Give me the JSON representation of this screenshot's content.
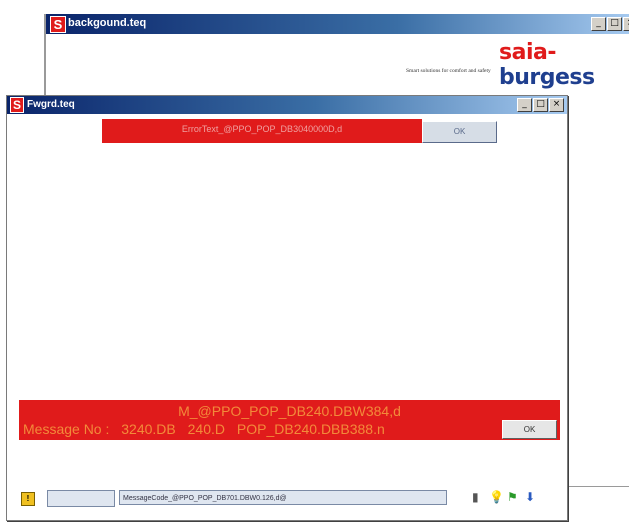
{
  "background_window": {
    "title": "backgound.teq",
    "brand_part1": "saia",
    "brand_sep": "-",
    "brand_part2": "burgess",
    "tagline": "Smart solutions for comfort and safety",
    "controls": [
      "_",
      "□",
      "×"
    ]
  },
  "dialog": {
    "title": "Fwgrd.teq",
    "controls": [
      "_",
      "□",
      "×"
    ],
    "error_text": "ErrorText_@PPO_POP_DB3040000D,d",
    "error_ok_label": "OK",
    "message_line1": "M_@PPO_POP_DB240.DBW384,d",
    "message_row": [
      "Message No :",
      "3240.DB",
      "240.D",
      "POP_DB240.DBB388.n"
    ],
    "message_ok_label": "OK"
  },
  "statusbar": {
    "warn_icon": "!",
    "message_text": "MessageCode_@PPO_POP_DB701.DBW0.126,d@",
    "icons": [
      "printer-icon",
      "bulb-icon",
      "flag-icon",
      "download-arrow-icon"
    ]
  },
  "colors": {
    "alarm_red": "#e01b1b",
    "titlebar_blue": "#0a246a",
    "brand_red": "#e01b1b",
    "brand_blue": "#1f3f8f"
  }
}
